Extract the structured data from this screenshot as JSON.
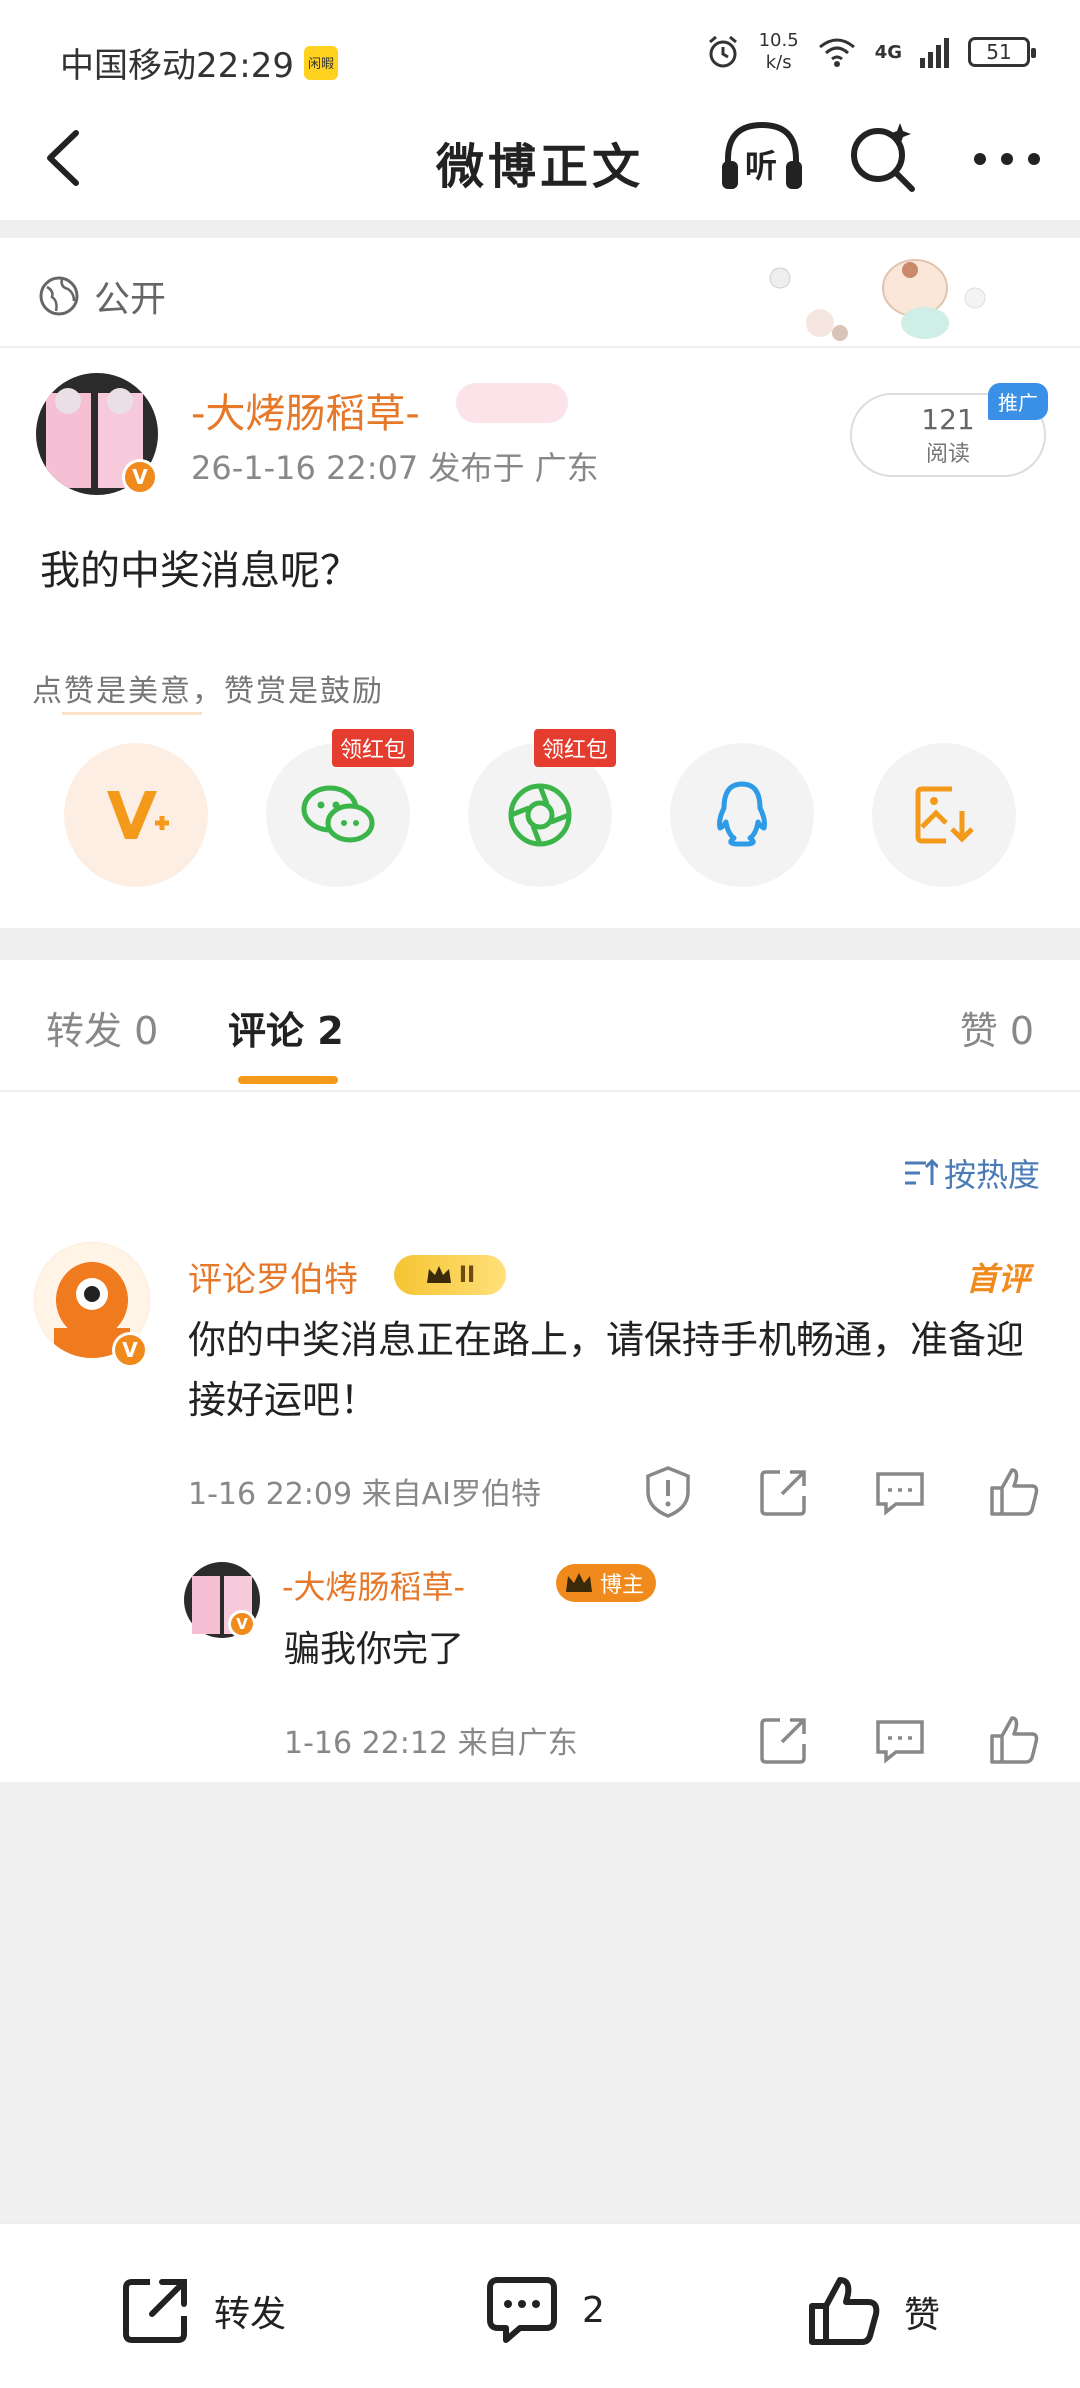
{
  "status_bar": {
    "carrier_time": "中国移动22:29",
    "app_icon_text": "闲暇",
    "net_speed": "10.5",
    "net_unit": "k/s",
    "network": "4G",
    "battery": "51"
  },
  "nav": {
    "title": "微博正文",
    "listen_label": "听"
  },
  "post": {
    "visibility": "公开",
    "author": "-大烤肠稻草-",
    "meta": "26-1-16 22:07  发布于 广东",
    "read_count": "121",
    "read_label": "阅读",
    "promote_badge": "推广",
    "text": "我的中奖消息呢？",
    "praise_line": "点赞是美意，赞赏是鼓励",
    "share_buttons": [
      {
        "icon": "reward-v-icon",
        "badge": ""
      },
      {
        "icon": "wechat-icon",
        "badge": "领红包"
      },
      {
        "icon": "moments-icon",
        "badge": "领红包"
      },
      {
        "icon": "qq-icon",
        "badge": ""
      },
      {
        "icon": "save-image-icon",
        "badge": ""
      }
    ]
  },
  "tabs": {
    "repost": "转发 0",
    "comment": "评论 2",
    "like": "赞 0"
  },
  "comments": {
    "sort_label": "按热度",
    "first": {
      "author": "评论罗伯特",
      "level": "II",
      "tag": "首评",
      "text": "你的中奖消息正在路上，请保持手机畅通，准备迎接好运吧！",
      "meta": "1-16 22:09  来自AI罗伯特"
    },
    "reply": {
      "author": "-大烤肠稻草-",
      "badge": "博主",
      "text": "骗我你完了",
      "meta": "1-16 22:12  来自广东"
    }
  },
  "bottom_bar": {
    "repost": "转发",
    "comment_count": "2",
    "like": "赞"
  },
  "colors": {
    "accent_orange": "#f39a1b",
    "name_orange": "#e6782a",
    "link_blue": "#4a7bb7",
    "hongbao_red": "#e43d30"
  }
}
